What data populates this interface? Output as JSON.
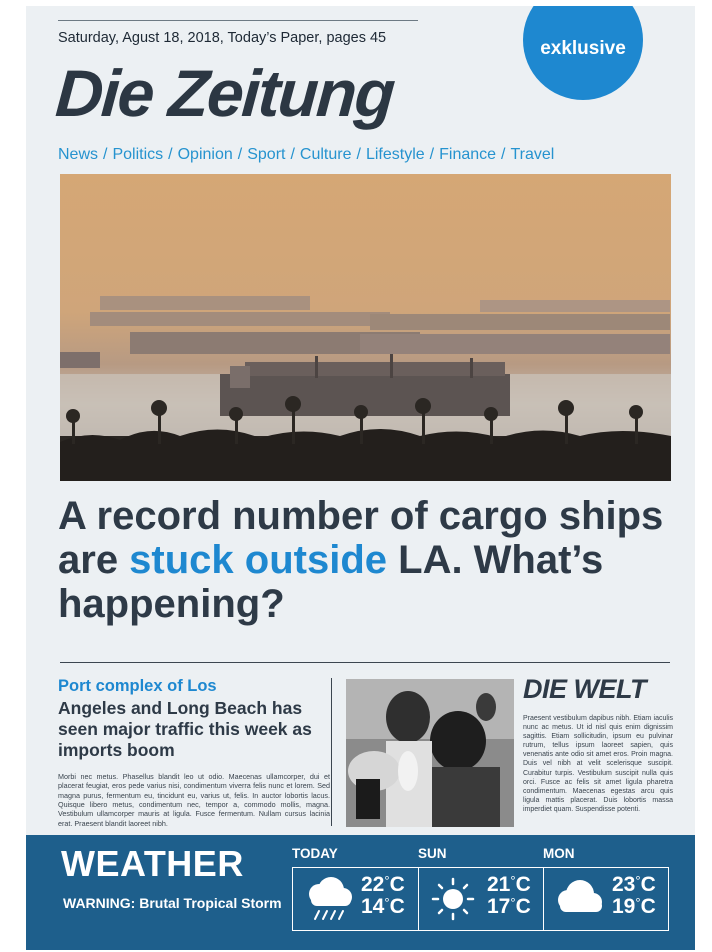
{
  "dateline": "Saturday, Agust 18, 2018, Today’s Paper, pages 45",
  "badge": "exklusive",
  "masthead": "Die Zeitung",
  "nav": [
    "News",
    "Politics",
    "Opinion",
    "Sport",
    "Culture",
    "Lifestyle",
    "Finance",
    "Travel"
  ],
  "nav_separator": "/",
  "headline": {
    "part1": "A record number of cargo ships are ",
    "highlight": "stuck outside",
    "part2": " LA. What’s happening?"
  },
  "subhead": {
    "kicker": "Port complex of Los",
    "text": "Angeles and Long Beach has seen major traffic this week as imports boom"
  },
  "body_left": "Morbi nec metus. Phasellus blandit leo ut odio. Maecenas ullamcorper, dui et placerat feugiat, eros pede varius nisi, condimentum viverra felis nunc et lorem. Sed magna purus, fermentum eu, tincidunt eu, varius ut, felis. In auctor lobortis lacus. Quisque libero metus, condimentum nec, tempor a, commodo mollis, magna. Vestibulum ullamcorper mauris at ligula. Fusce fermentum. Nullam cursus lacinia erat. Praesent blandit laoreet nibh.",
  "sidebar": {
    "title": "DIE WELT",
    "body": "Praesent vestibulum dapibus nibh. Etiam iaculis nunc ac metus. Ut id nisl quis enim dignissim sagittis. Etiam sollicitudin, ipsum eu pulvinar rutrum, tellus ipsum laoreet sapien, quis venenatis ante odio sit amet eros. Proin magna. Duis vel nibh at velit scelerisque suscipit. Curabitur turpis. Vestibulum suscipit nulla quis orci. Fusce ac felis sit amet ligula pharetra condimentum. Maecenas egestas arcu quis ligula mattis placerat. Duis lobortis massa imperdiet quam. Suspendisse potenti."
  },
  "weather": {
    "title": "WEATHER",
    "warning": "WARNING: Brutal Tropical Storm",
    "days": [
      {
        "label": "TODAY",
        "icon": "rain-cloud-icon",
        "high": "22",
        "low": "14"
      },
      {
        "label": "SUN",
        "icon": "sun-icon",
        "high": "21",
        "low": "17"
      },
      {
        "label": "MON",
        "icon": "cloud-icon",
        "high": "23",
        "low": "19"
      }
    ],
    "unit": "C"
  },
  "colors": {
    "accent": "#1e88d0",
    "weather_bar": "#1e5f8c",
    "text": "#2e3a47",
    "page": "#ecf0f3"
  }
}
